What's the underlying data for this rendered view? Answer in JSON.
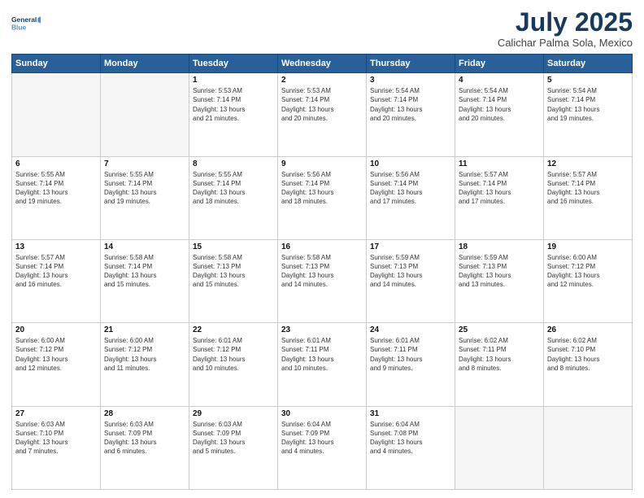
{
  "logo": {
    "line1": "General",
    "line2": "Blue"
  },
  "title": "July 2025",
  "subtitle": "Calichar Palma Sola, Mexico",
  "days_header": [
    "Sunday",
    "Monday",
    "Tuesday",
    "Wednesday",
    "Thursday",
    "Friday",
    "Saturday"
  ],
  "weeks": [
    [
      {
        "day": "",
        "info": ""
      },
      {
        "day": "",
        "info": ""
      },
      {
        "day": "1",
        "info": "Sunrise: 5:53 AM\nSunset: 7:14 PM\nDaylight: 13 hours\nand 21 minutes."
      },
      {
        "day": "2",
        "info": "Sunrise: 5:53 AM\nSunset: 7:14 PM\nDaylight: 13 hours\nand 20 minutes."
      },
      {
        "day": "3",
        "info": "Sunrise: 5:54 AM\nSunset: 7:14 PM\nDaylight: 13 hours\nand 20 minutes."
      },
      {
        "day": "4",
        "info": "Sunrise: 5:54 AM\nSunset: 7:14 PM\nDaylight: 13 hours\nand 20 minutes."
      },
      {
        "day": "5",
        "info": "Sunrise: 5:54 AM\nSunset: 7:14 PM\nDaylight: 13 hours\nand 19 minutes."
      }
    ],
    [
      {
        "day": "6",
        "info": "Sunrise: 5:55 AM\nSunset: 7:14 PM\nDaylight: 13 hours\nand 19 minutes."
      },
      {
        "day": "7",
        "info": "Sunrise: 5:55 AM\nSunset: 7:14 PM\nDaylight: 13 hours\nand 19 minutes."
      },
      {
        "day": "8",
        "info": "Sunrise: 5:55 AM\nSunset: 7:14 PM\nDaylight: 13 hours\nand 18 minutes."
      },
      {
        "day": "9",
        "info": "Sunrise: 5:56 AM\nSunset: 7:14 PM\nDaylight: 13 hours\nand 18 minutes."
      },
      {
        "day": "10",
        "info": "Sunrise: 5:56 AM\nSunset: 7:14 PM\nDaylight: 13 hours\nand 17 minutes."
      },
      {
        "day": "11",
        "info": "Sunrise: 5:57 AM\nSunset: 7:14 PM\nDaylight: 13 hours\nand 17 minutes."
      },
      {
        "day": "12",
        "info": "Sunrise: 5:57 AM\nSunset: 7:14 PM\nDaylight: 13 hours\nand 16 minutes."
      }
    ],
    [
      {
        "day": "13",
        "info": "Sunrise: 5:57 AM\nSunset: 7:14 PM\nDaylight: 13 hours\nand 16 minutes."
      },
      {
        "day": "14",
        "info": "Sunrise: 5:58 AM\nSunset: 7:14 PM\nDaylight: 13 hours\nand 15 minutes."
      },
      {
        "day": "15",
        "info": "Sunrise: 5:58 AM\nSunset: 7:13 PM\nDaylight: 13 hours\nand 15 minutes."
      },
      {
        "day": "16",
        "info": "Sunrise: 5:58 AM\nSunset: 7:13 PM\nDaylight: 13 hours\nand 14 minutes."
      },
      {
        "day": "17",
        "info": "Sunrise: 5:59 AM\nSunset: 7:13 PM\nDaylight: 13 hours\nand 14 minutes."
      },
      {
        "day": "18",
        "info": "Sunrise: 5:59 AM\nSunset: 7:13 PM\nDaylight: 13 hours\nand 13 minutes."
      },
      {
        "day": "19",
        "info": "Sunrise: 6:00 AM\nSunset: 7:12 PM\nDaylight: 13 hours\nand 12 minutes."
      }
    ],
    [
      {
        "day": "20",
        "info": "Sunrise: 6:00 AM\nSunset: 7:12 PM\nDaylight: 13 hours\nand 12 minutes."
      },
      {
        "day": "21",
        "info": "Sunrise: 6:00 AM\nSunset: 7:12 PM\nDaylight: 13 hours\nand 11 minutes."
      },
      {
        "day": "22",
        "info": "Sunrise: 6:01 AM\nSunset: 7:12 PM\nDaylight: 13 hours\nand 10 minutes."
      },
      {
        "day": "23",
        "info": "Sunrise: 6:01 AM\nSunset: 7:11 PM\nDaylight: 13 hours\nand 10 minutes."
      },
      {
        "day": "24",
        "info": "Sunrise: 6:01 AM\nSunset: 7:11 PM\nDaylight: 13 hours\nand 9 minutes."
      },
      {
        "day": "25",
        "info": "Sunrise: 6:02 AM\nSunset: 7:11 PM\nDaylight: 13 hours\nand 8 minutes."
      },
      {
        "day": "26",
        "info": "Sunrise: 6:02 AM\nSunset: 7:10 PM\nDaylight: 13 hours\nand 8 minutes."
      }
    ],
    [
      {
        "day": "27",
        "info": "Sunrise: 6:03 AM\nSunset: 7:10 PM\nDaylight: 13 hours\nand 7 minutes."
      },
      {
        "day": "28",
        "info": "Sunrise: 6:03 AM\nSunset: 7:09 PM\nDaylight: 13 hours\nand 6 minutes."
      },
      {
        "day": "29",
        "info": "Sunrise: 6:03 AM\nSunset: 7:09 PM\nDaylight: 13 hours\nand 5 minutes."
      },
      {
        "day": "30",
        "info": "Sunrise: 6:04 AM\nSunset: 7:09 PM\nDaylight: 13 hours\nand 4 minutes."
      },
      {
        "day": "31",
        "info": "Sunrise: 6:04 AM\nSunset: 7:08 PM\nDaylight: 13 hours\nand 4 minutes."
      },
      {
        "day": "",
        "info": ""
      },
      {
        "day": "",
        "info": ""
      }
    ]
  ]
}
